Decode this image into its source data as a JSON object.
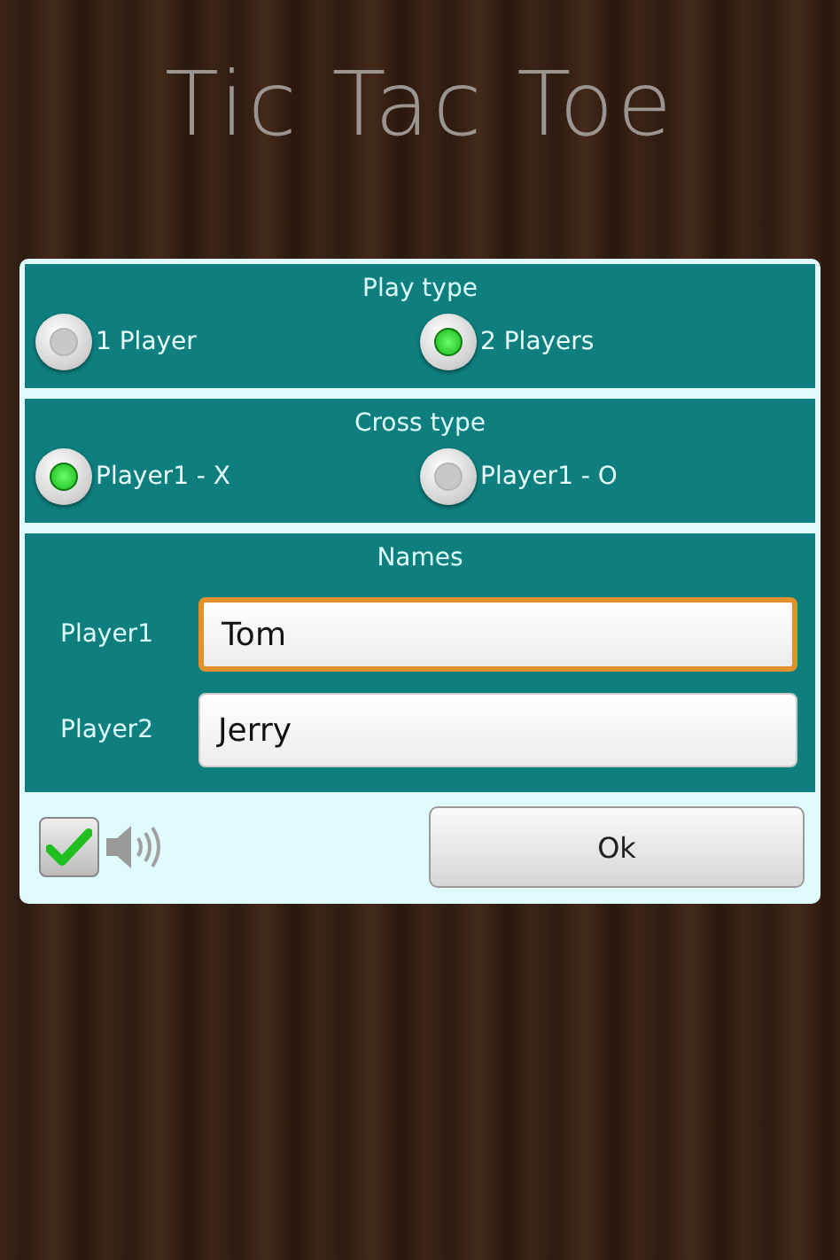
{
  "title": "Tic Tac Toe",
  "sections": [
    {
      "kind": "radio",
      "title": "Play type",
      "options": [
        {
          "label": "1 Player",
          "selected": false
        },
        {
          "label": "2 Players",
          "selected": true
        }
      ]
    },
    {
      "kind": "radio",
      "title": "Cross type",
      "options": [
        {
          "label": "Player1 - X",
          "selected": true
        },
        {
          "label": "Player1 - O",
          "selected": false
        }
      ]
    },
    {
      "kind": "names",
      "title": "Names",
      "fields": [
        {
          "label": "Player1",
          "value": "Tom",
          "focused": true
        },
        {
          "label": "Player2",
          "value": "Jerry",
          "focused": false
        }
      ]
    }
  ],
  "sound": {
    "checked": true
  },
  "ok_button": "Ok"
}
